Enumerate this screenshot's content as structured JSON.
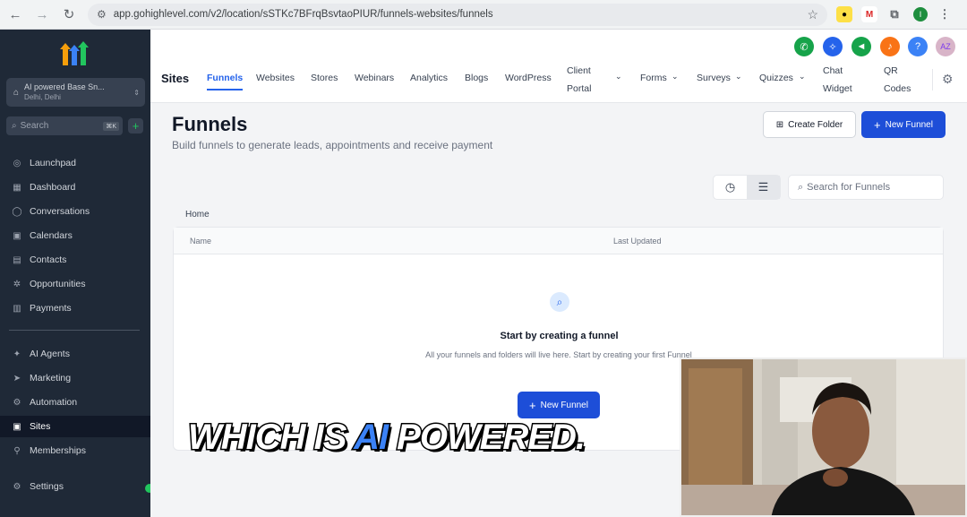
{
  "browser": {
    "url": "app.gohighlevel.com/v2/location/sSTKc7BFrqBsvtaoPIUR/funnels-websites/funnels"
  },
  "sidebar": {
    "location_name": "AI powered Base Sn...",
    "location_sub": "Delhi, Delhi",
    "search_placeholder": "Search",
    "search_kbd": "⌘K",
    "items": [
      {
        "label": "Launchpad"
      },
      {
        "label": "Dashboard"
      },
      {
        "label": "Conversations"
      },
      {
        "label": "Calendars"
      },
      {
        "label": "Contacts"
      },
      {
        "label": "Opportunities"
      },
      {
        "label": "Payments"
      },
      {
        "label": "AI Agents"
      },
      {
        "label": "Marketing"
      },
      {
        "label": "Automation"
      },
      {
        "label": "Sites"
      },
      {
        "label": "Memberships"
      },
      {
        "label": "Settings"
      }
    ]
  },
  "topbar": {
    "section": "Sites",
    "tabs": [
      "Funnels",
      "Websites",
      "Stores",
      "Webinars",
      "Analytics",
      "Blogs",
      "WordPress"
    ],
    "tab_client_portal": [
      "Client",
      "Portal"
    ],
    "tab_forms": "Forms",
    "tab_surveys": "Surveys",
    "tab_quizzes": "Quizzes",
    "tab_chat_widget": [
      "Chat",
      "Widget"
    ],
    "tab_qr_codes": [
      "QR",
      "Codes"
    ],
    "avatar_initials": "AZ"
  },
  "main": {
    "title": "Funnels",
    "subtitle": "Build funnels to generate leads, appointments and receive payment",
    "create_folder": "Create Folder",
    "new_funnel": "New Funnel",
    "search_placeholder": "Search for Funnels",
    "breadcrumb": "Home",
    "columns": [
      "Name",
      "Last Updated"
    ],
    "empty_title": "Start by creating a funnel",
    "empty_sub": "All your funnels and folders will live here. Start by creating your first Funnel",
    "empty_button": "New Funnel"
  },
  "overlay": {
    "caption_pre": "WHICH IS ",
    "caption_ai": "AI",
    "caption_post": " POWERED."
  },
  "colors": {
    "accent": "#1d4ed8",
    "sidebar": "#1f2937"
  }
}
